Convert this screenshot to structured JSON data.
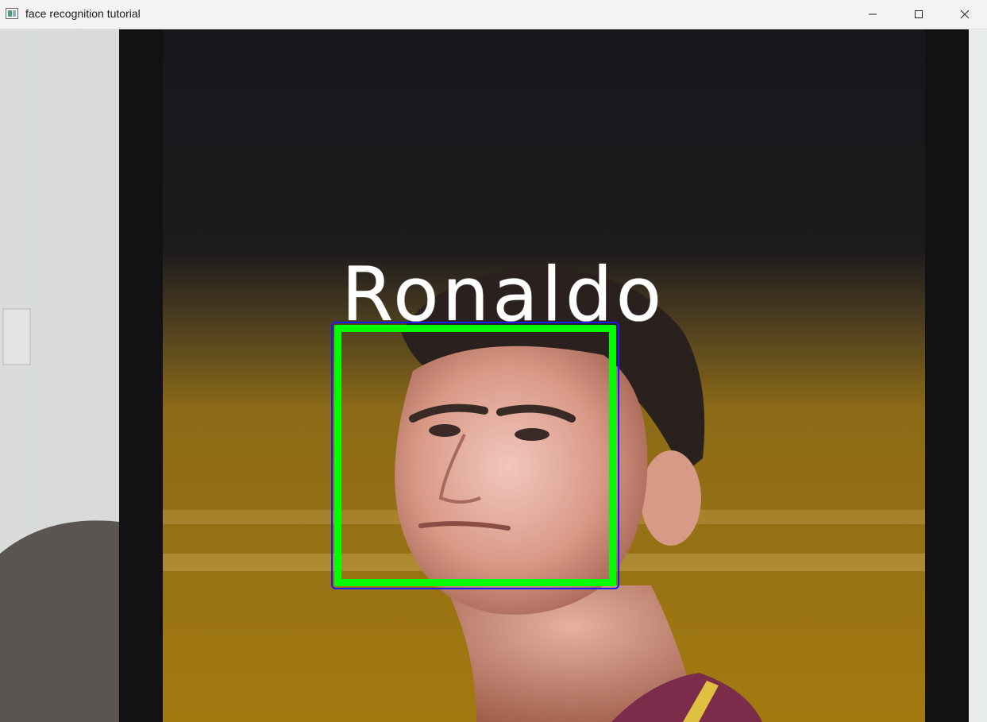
{
  "window": {
    "title": "face recognition tutorial",
    "icon": "app-window-icon",
    "controls": [
      "minimize-icon",
      "maximize-icon",
      "close-icon"
    ]
  },
  "detection": {
    "label": "Ronaldo",
    "label_color": "#ffffff",
    "box_outer_color": "#1a1aff",
    "box_inner_color": "#00ff00"
  }
}
